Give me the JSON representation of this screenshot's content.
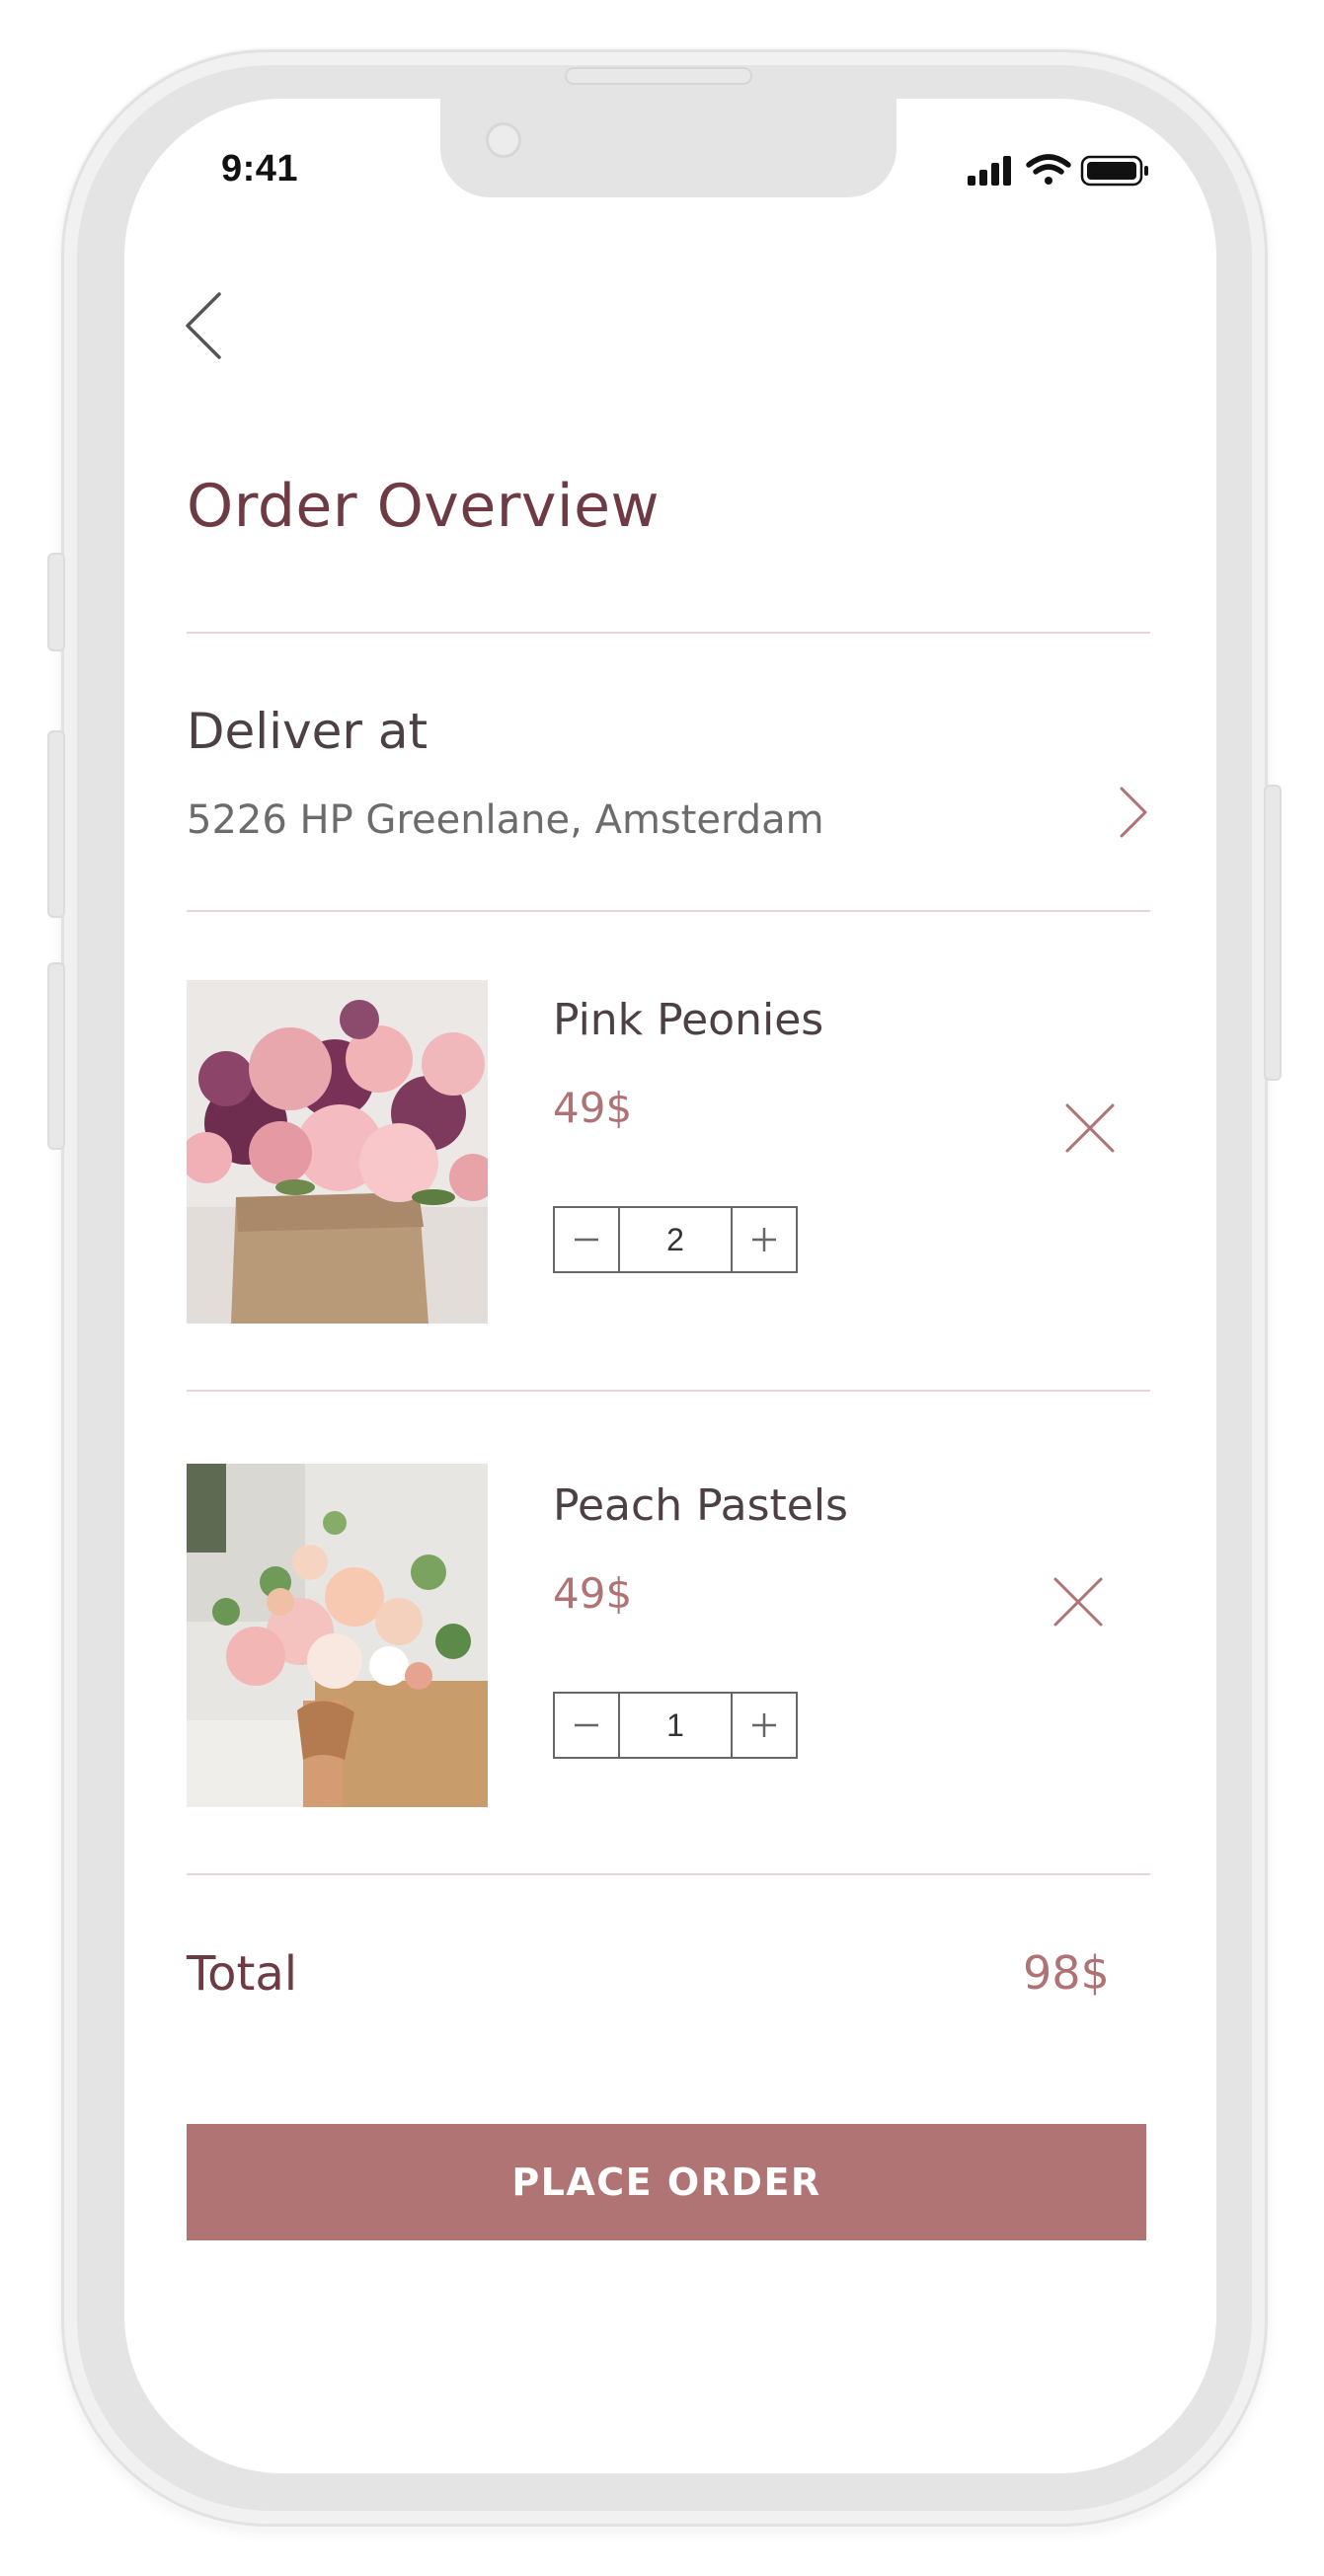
{
  "status_bar": {
    "time": "9:41",
    "icons": [
      "cellular-signal-icon",
      "wifi-icon",
      "battery-icon"
    ]
  },
  "header": {
    "back_icon": "chevron-left-icon",
    "title": "Order Overview"
  },
  "delivery": {
    "label": "Deliver at",
    "address": "5226 HP Greenlane, Amsterdam",
    "chevron_icon": "chevron-right-icon"
  },
  "cart": {
    "items": [
      {
        "name": "Pink Peonies",
        "price": "49$",
        "quantity": "2",
        "image": "pink-peonies-bouquet-photo",
        "remove_icon": "close-icon",
        "decrement_icon": "minus-icon",
        "increment_icon": "plus-icon"
      },
      {
        "name": "Peach Pastels",
        "price": "49$",
        "quantity": "1",
        "image": "peach-pastels-bouquet-photo",
        "remove_icon": "close-icon",
        "decrement_icon": "minus-icon",
        "increment_icon": "plus-icon"
      }
    ]
  },
  "summary": {
    "total_label": "Total",
    "total_value": "98$"
  },
  "actions": {
    "place_order_label": "PLACE ORDER"
  },
  "colors": {
    "title": "#6e3a44",
    "price_accent": "#b07375",
    "button_bg": "#b07474",
    "divider": "#e7d6d8",
    "text_dark": "#4d4044"
  }
}
